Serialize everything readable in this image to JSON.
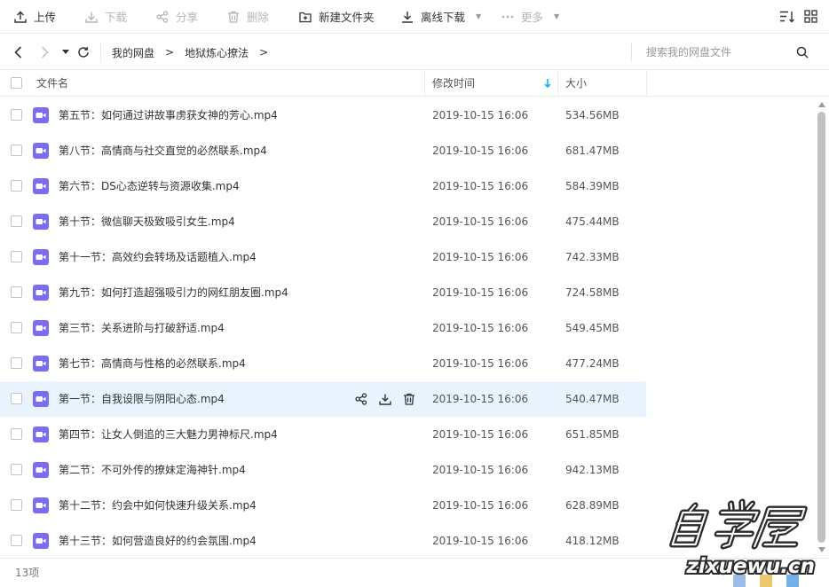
{
  "toolbar": {
    "upload": "上传",
    "download": "下载",
    "share": "分享",
    "delete": "删除",
    "new_folder": "新建文件夹",
    "offline_download": "离线下载",
    "more": "更多"
  },
  "nav": {
    "breadcrumb": [
      "我的网盘",
      "地狱炼心撩法"
    ],
    "search_placeholder": "搜索我的网盘文件"
  },
  "table": {
    "headers": {
      "name": "文件名",
      "modified": "修改时间",
      "size": "大小"
    },
    "sort_column": "修改时间",
    "rows": [
      {
        "name": "第五节：如何通过讲故事虏获女神的芳心.mp4",
        "modified": "2019-10-15 16:06",
        "size": "534.56MB"
      },
      {
        "name": "第八节：高情商与社交直觉的必然联系.mp4",
        "modified": "2019-10-15 16:06",
        "size": "681.47MB"
      },
      {
        "name": "第六节：DS心态逆转与资源收集.mp4",
        "modified": "2019-10-15 16:06",
        "size": "584.39MB"
      },
      {
        "name": "第十节：微信聊天极致吸引女生.mp4",
        "modified": "2019-10-15 16:06",
        "size": "475.44MB"
      },
      {
        "name": "第十一节：高效约会转场及话题植入.mp4",
        "modified": "2019-10-15 16:06",
        "size": "742.33MB"
      },
      {
        "name": "第九节：如何打造超强吸引力的网红朋友圈.mp4",
        "modified": "2019-10-15 16:06",
        "size": "724.58MB"
      },
      {
        "name": "第三节：关系进阶与打破舒适.mp4",
        "modified": "2019-10-15 16:06",
        "size": "549.45MB"
      },
      {
        "name": "第七节：高情商与性格的必然联系.mp4",
        "modified": "2019-10-15 16:06",
        "size": "477.24MB"
      },
      {
        "name": "第一节：自我设限与阴阳心态.mp4",
        "modified": "2019-10-15 16:06",
        "size": "540.47MB"
      },
      {
        "name": "第四节：让女人倒追的三大魅力男神标尺.mp4",
        "modified": "2019-10-15 16:06",
        "size": "651.85MB"
      },
      {
        "name": "第二节：不可外传的撩妹定海神针.mp4",
        "modified": "2019-10-15 16:06",
        "size": "942.13MB"
      },
      {
        "name": "第十二节：约会中如何快速升级关系.mp4",
        "modified": "2019-10-15 16:06",
        "size": "628.89MB"
      },
      {
        "name": "第十三节：如何营造良好的约会氛围.mp4",
        "modified": "2019-10-15 16:06",
        "size": "418.12MB"
      }
    ],
    "hovered_row": 8
  },
  "footer": {
    "count": "13项"
  },
  "watermark": {
    "title": "自学屋",
    "url": "zixuewu.cn"
  },
  "colors": {
    "accent": "#06a7ff",
    "video_icon": "#7b6cf6",
    "hover_row": "#e8f3fd"
  }
}
